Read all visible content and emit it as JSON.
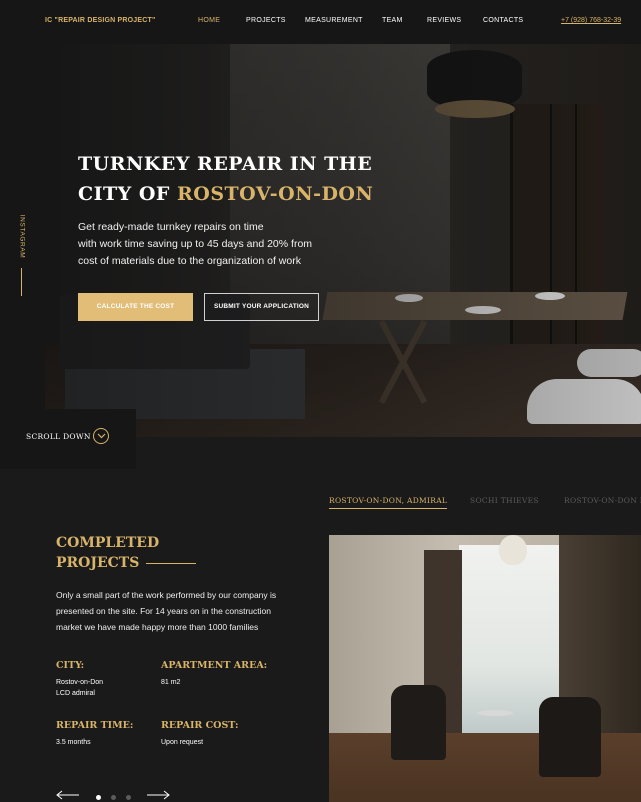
{
  "header": {
    "brand": "IC \"REPAIR DESIGN PROJECT\"",
    "nav": [
      "HOME",
      "PROJECTS",
      "MEASUREMENT",
      "TEAM",
      "REVIEWS",
      "CONTACTS"
    ],
    "active_nav": "HOME",
    "phone": "+7 (928) 768-32-39"
  },
  "sidebar": {
    "social": "INSTAGRAM"
  },
  "hero": {
    "title_line1": "TURNKEY REPAIR IN THE",
    "title_line2_prefix": "CITY OF ",
    "title_line2_highlight": "ROSTOV-ON-DON",
    "lead_line1": "Get ready-made turnkey repairs on time",
    "lead_line2": "with work time saving up to 45 days and 20% from",
    "lead_line3": "cost of materials due to the organization of work",
    "primary_button": "CALCULATE THE COST",
    "secondary_button": "SUBMIT YOUR APPLICATION"
  },
  "scroll": {
    "label": "SCROLL DOWN"
  },
  "projects": {
    "tabs": [
      "ROSTOV-ON-DON, ADMIRAL",
      "SOCHI THIEVES",
      "ROSTOV-ON-DON PA"
    ],
    "active_tab": 0,
    "title_line1": "COMPLETED",
    "title_line2": "PROJECTS",
    "description_line1": "Only a small part of the work performed by our company is",
    "description_line2": "presented on the site. For 14 years on in the construction",
    "description_line3": "market we have made happy more than 1000 families",
    "city_label": "CITY:",
    "city_value_line1": "Rostov-on-Don",
    "city_value_line2": "LCD admiral",
    "area_label": "APARTMENT AREA:",
    "area_value": "81 m2",
    "time_label": "REPAIR TIME:",
    "time_value": "3.5 months",
    "cost_label": "REPAIR COST:",
    "cost_value": "Upon request",
    "slider_dots": 3,
    "active_dot": 0
  },
  "colors": {
    "accent": "#d8b46a",
    "button": "#e2bd78",
    "background": "#1a1a1a",
    "panel": "#161616"
  }
}
